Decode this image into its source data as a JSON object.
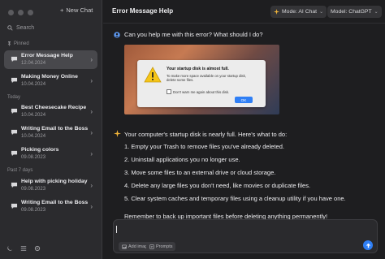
{
  "sidebar": {
    "new_chat_label": "New Chat",
    "search_placeholder": "Search",
    "sections": {
      "pinned": "Pinned",
      "today": "Today",
      "past7": "Past 7 days"
    },
    "items": [
      {
        "title": "Error Message Help",
        "date": "12.04.2024",
        "active": true
      },
      {
        "title": "Making Money Online",
        "date": "10.04.2024"
      },
      {
        "title": "Best Cheesecake Recipe",
        "date": "10.04.2024"
      },
      {
        "title": "Writing Email to the Boss",
        "date": "10.04.2024"
      },
      {
        "title": "Picking colors",
        "date": "09.08.2023"
      },
      {
        "title": "Help with picking holiday",
        "date": "09.08.2023"
      },
      {
        "title": "Writing Email to the Boss",
        "date": "09.08.2023"
      }
    ]
  },
  "header": {
    "title": "Error Message Help",
    "mode_label": "Mode: AI Chat",
    "model_label": "Model: ChatGPT"
  },
  "messages": {
    "user_text": "Can you help me with this error? What should I do?",
    "screenshot": {
      "title": "Your startup disk is almost full.",
      "body": "To make more space available on your startup disk, delete some files.",
      "checkbox": "Don't warn me again about this disk.",
      "ok": "OK"
    },
    "ai_intro": "Your computer's startup disk is nearly full. Here's what to do:",
    "ai_steps": [
      "1. Empty your Trash to remove files you've already deleted.",
      "2. Uninstall applications you no longer use.",
      "3. Move some files to an external drive or cloud storage.",
      "4. Delete any large files you don't need, like movies or duplicate files.",
      "5. Clear system caches and temporary files using a cleanup utility if you have one."
    ],
    "ai_outro": "Remember to back up important files before deleting anything permanently!"
  },
  "composer": {
    "value": "",
    "add_image_label": "Add image",
    "prompts_label": "Prompts"
  },
  "colors": {
    "accent": "#2f7ff5",
    "sidebar_bg": "#2b2b2e",
    "main_bg": "#1e1e20",
    "warning": "#f5c518"
  }
}
